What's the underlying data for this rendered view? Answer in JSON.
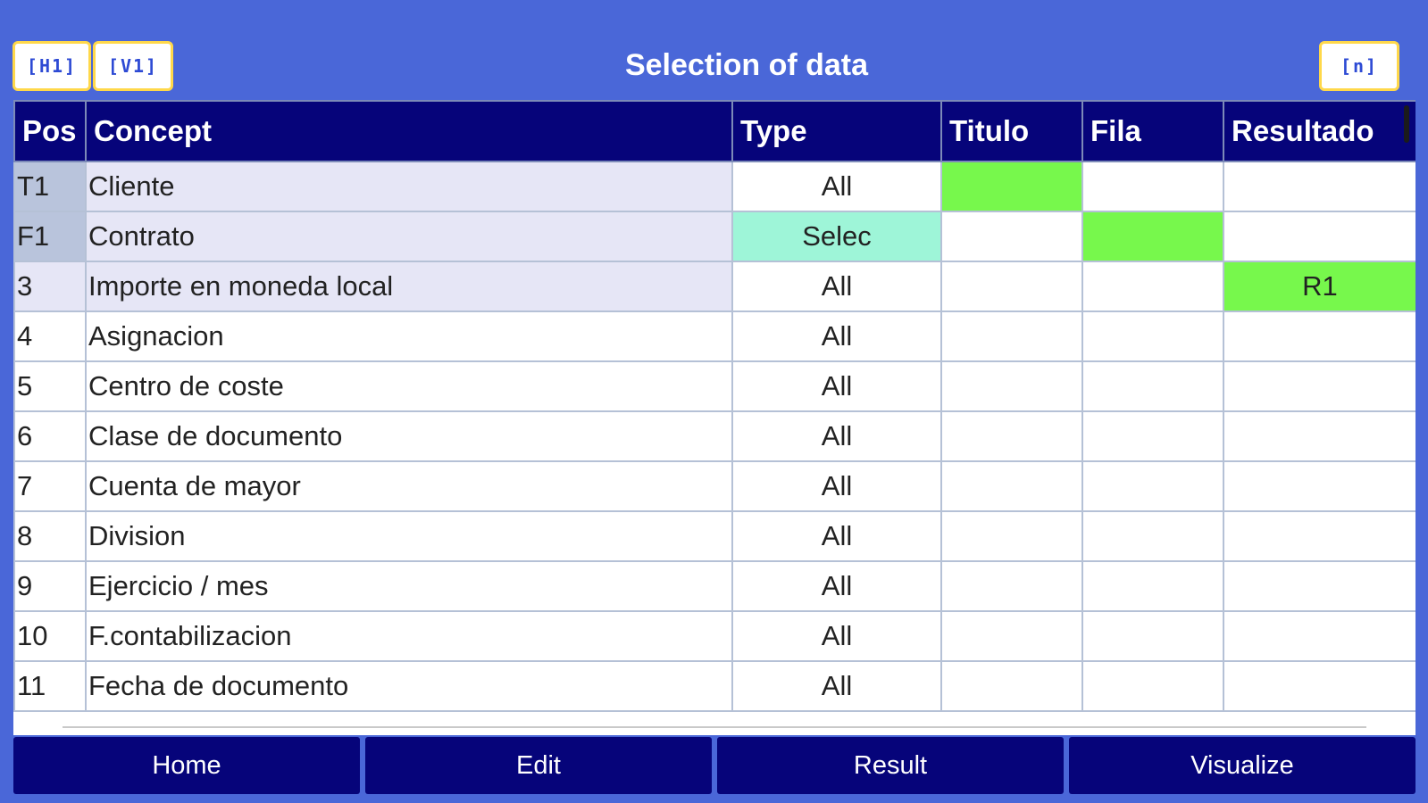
{
  "header": {
    "title": "Selection of data",
    "btn_h1": "[H1]",
    "btn_v1": "[V1]",
    "btn_n": "[n]"
  },
  "table": {
    "columns": [
      "Pos",
      "Concept",
      "Type",
      "Titulo",
      "Fila",
      "Resultado"
    ],
    "rows": [
      {
        "pos": "T1",
        "concept": "Cliente",
        "type": "All",
        "titulo": "",
        "fila": "",
        "resultado": ""
      },
      {
        "pos": "F1",
        "concept": "Contrato",
        "type": "Selec",
        "titulo": "",
        "fila": "",
        "resultado": ""
      },
      {
        "pos": "3",
        "concept": "Importe en moneda local",
        "type": "All",
        "titulo": "",
        "fila": "",
        "resultado": "R1"
      },
      {
        "pos": "4",
        "concept": "Asignacion",
        "type": "All",
        "titulo": "",
        "fila": "",
        "resultado": ""
      },
      {
        "pos": "5",
        "concept": "Centro de coste",
        "type": "All",
        "titulo": "",
        "fila": "",
        "resultado": ""
      },
      {
        "pos": "6",
        "concept": "Clase de documento",
        "type": "All",
        "titulo": "",
        "fila": "",
        "resultado": ""
      },
      {
        "pos": "7",
        "concept": "Cuenta de mayor",
        "type": "All",
        "titulo": "",
        "fila": "",
        "resultado": ""
      },
      {
        "pos": "8",
        "concept": "Division",
        "type": "All",
        "titulo": "",
        "fila": "",
        "resultado": ""
      },
      {
        "pos": "9",
        "concept": "Ejercicio / mes",
        "type": "All",
        "titulo": "",
        "fila": "",
        "resultado": ""
      },
      {
        "pos": "10",
        "concept": "F.contabilizacion",
        "type": "All",
        "titulo": "",
        "fila": "",
        "resultado": ""
      },
      {
        "pos": "11",
        "concept": "Fecha de documento",
        "type": "All",
        "titulo": "",
        "fila": "",
        "resultado": ""
      }
    ]
  },
  "highlights": {
    "green": "#77f84c",
    "aqua": "#9ef5d8",
    "header_bg": "#06047a",
    "page_bg": "#4a67d8"
  },
  "nav": {
    "home": "Home",
    "edit": "Edit",
    "result": "Result",
    "visualize": "Visualize"
  }
}
